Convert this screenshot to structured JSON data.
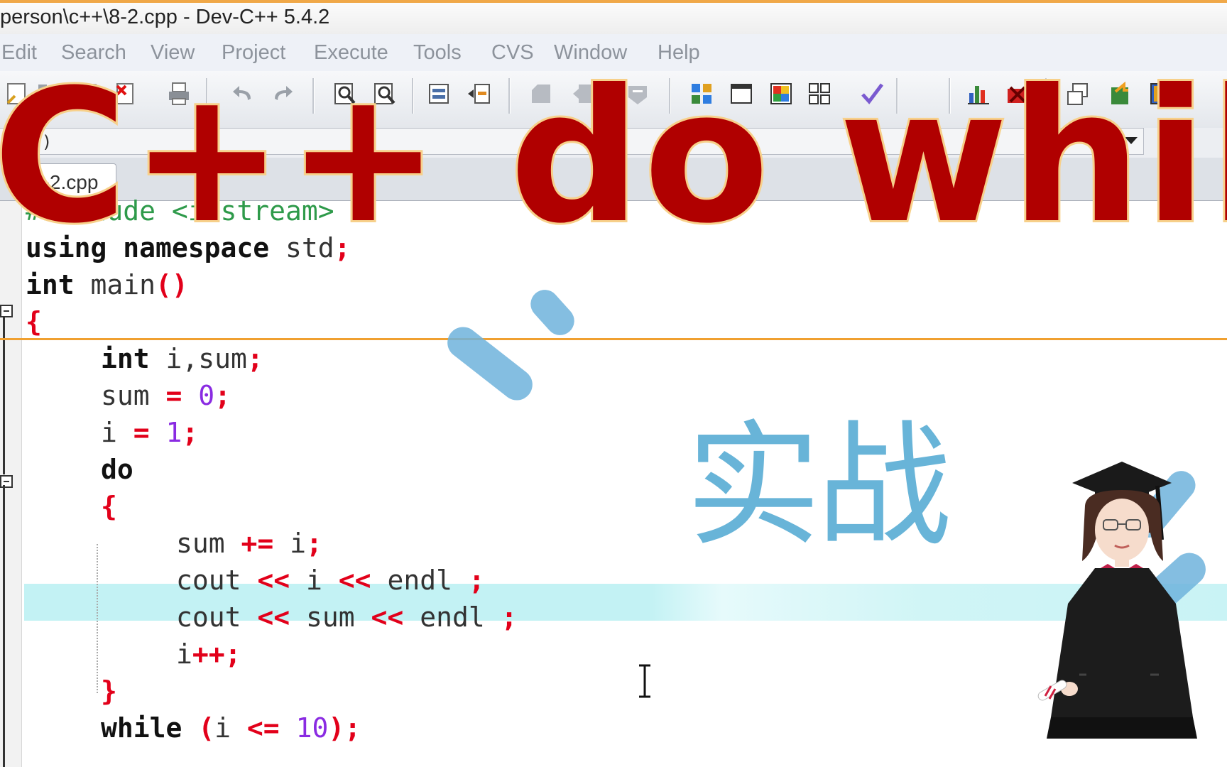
{
  "window": {
    "title": "person\\c++\\8-2.cpp - Dev-C++ 5.4.2"
  },
  "menu": [
    "Edit",
    "Search",
    "View",
    "Project",
    "Execute",
    "Tools",
    "CVS",
    "Window",
    "Help"
  ],
  "classbar": {
    "text": "ls)"
  },
  "tabs": [
    {
      "label": "8-2.cpp"
    }
  ],
  "code": {
    "line1_a": "#include",
    "line1_b": " <iostream>",
    "line2_a": "using namespace",
    "line2_b": " std",
    "line2_c": ";",
    "line3_a": "int",
    "line3_b": " main",
    "line3_c": "()",
    "line4_a": "{",
    "line5_a": "int",
    "line5_b": " i,sum",
    "line5_c": ";",
    "line6_a": "sum ",
    "line6_b": "=",
    "line6_c": " 0",
    "line6_d": ";",
    "line7_a": "i ",
    "line7_b": "=",
    "line7_c": " 1",
    "line7_d": ";",
    "line8_a": "do",
    "line9_a": "{",
    "line10_a": "sum ",
    "line10_b": "+=",
    "line10_c": " i",
    "line10_d": ";",
    "line11_a": "cout ",
    "line11_b": "<<",
    "line11_c": " i ",
    "line11_d": "<<",
    "line11_e": " endl ",
    "line11_f": ";",
    "line12_a": "cout ",
    "line12_b": "<<",
    "line12_c": " sum ",
    "line12_d": "<<",
    "line12_e": " endl ",
    "line12_f": ";",
    "line13_a": "i",
    "line13_b": "++",
    "line13_c": ";",
    "line14_a": "}",
    "line15_a": "while",
    "line15_b": " (",
    "line15_c": "i ",
    "line15_d": "<=",
    "line15_e": " 10",
    "line15_f": ");"
  },
  "overlay": {
    "title": "C++ do while",
    "subtitle": "实战"
  },
  "colors": {
    "title_fill": "#b00000",
    "title_stroke": "#f7d08a",
    "subtitle": "#68b4d8",
    "highlight_line": "#c3f2f4",
    "operator": "#e2001a",
    "number": "#8a2be2",
    "preprocessor": "#2e9a4a"
  },
  "icons": [
    "new-file-icon",
    "open-icon",
    "save-icon",
    "close-file-icon",
    "print-icon",
    "undo-icon",
    "redo-icon",
    "find-icon",
    "find-replace-icon",
    "indent-icon",
    "unindent-icon",
    "bookmark-icon",
    "goto-icon",
    "debug-icon",
    "grid-icon",
    "window-icon",
    "color-grid-icon",
    "tile-icon",
    "check-icon",
    "chart-icon",
    "stop-icon",
    "project-icon",
    "export-icon",
    "book-icon"
  ]
}
